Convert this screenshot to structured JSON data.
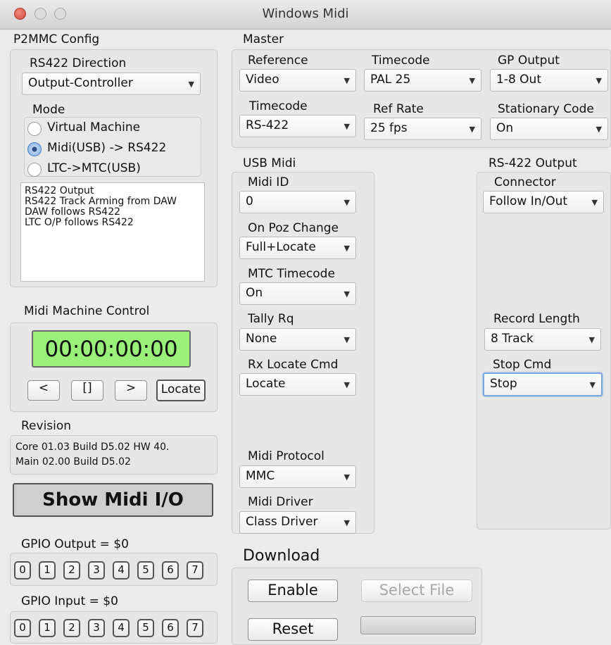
{
  "window": {
    "title": "Windows Midi"
  },
  "p2mmc": {
    "title": "P2MMC Config",
    "rs422_direction_label": "RS422 Direction",
    "rs422_direction_value": "Output-Controller",
    "mode_label": "Mode",
    "modes": [
      "Virtual Machine",
      "Midi(USB) -> RS422",
      "LTC->MTC(USB)"
    ],
    "selected_mode": 1,
    "info_lines": [
      "RS422 Output",
      "RS422 Track Arming from DAW",
      "DAW follows RS422",
      "LTC O/P follows RS422"
    ]
  },
  "mmc": {
    "title": "Midi Machine Control",
    "timecode": "00:00:00:00",
    "buttons": [
      "<",
      "[]",
      ">",
      "Locate"
    ]
  },
  "revision": {
    "title": "Revision",
    "lines": [
      "Core 01.03 Build D5.02 HW 40.",
      "Main 02.00 Build D5.02"
    ]
  },
  "show_midi_io": "Show Midi I/O",
  "gpio": {
    "output_label": "GPIO Output = $0",
    "input_label": "GPIO Input = $0",
    "bits": [
      "0",
      "1",
      "2",
      "3",
      "4",
      "5",
      "6",
      "7"
    ]
  },
  "master": {
    "title": "Master",
    "reference_label": "Reference",
    "reference_value": "Video",
    "timecode_label": "Timecode",
    "timecode_value": "PAL 25",
    "gp_output_label": "GP Output",
    "gp_output_value": "1-8 Out",
    "timecode2_label": "Timecode",
    "timecode2_value": "RS-422",
    "ref_rate_label": "Ref Rate",
    "ref_rate_value": "25 fps",
    "stationary_label": "Stationary Code",
    "stationary_value": "On"
  },
  "usb_midi": {
    "title": "USB Midi",
    "midi_id_label": "Midi ID",
    "midi_id_value": "0",
    "on_poz_label": "On Poz Change",
    "on_poz_value": "Full+Locate",
    "mtc_label": "MTC Timecode",
    "mtc_value": "On",
    "tally_label": "Tally Rq",
    "tally_value": "None",
    "rx_locate_label": "Rx Locate Cmd",
    "rx_locate_value": "Locate",
    "protocol_label": "Midi Protocol",
    "protocol_value": "MMC",
    "driver_label": "Midi Driver",
    "driver_value": "Class Driver"
  },
  "rs422_output": {
    "title": "RS-422 Output",
    "connector_label": "Connector",
    "connector_value": "Follow In/Out",
    "record_length_label": "Record Length",
    "record_length_value": "8 Track",
    "stop_cmd_label": "Stop Cmd",
    "stop_cmd_value": "Stop"
  },
  "download": {
    "title": "Download",
    "enable": "Enable",
    "select_file": "Select File",
    "reset": "Reset"
  },
  "colors": {
    "lcd": "#9af07a",
    "focus": "#7aa6e0",
    "close": "#d2463a"
  },
  "icons": {
    "popup_arrow": "▼",
    "radio": "radio-icon"
  }
}
